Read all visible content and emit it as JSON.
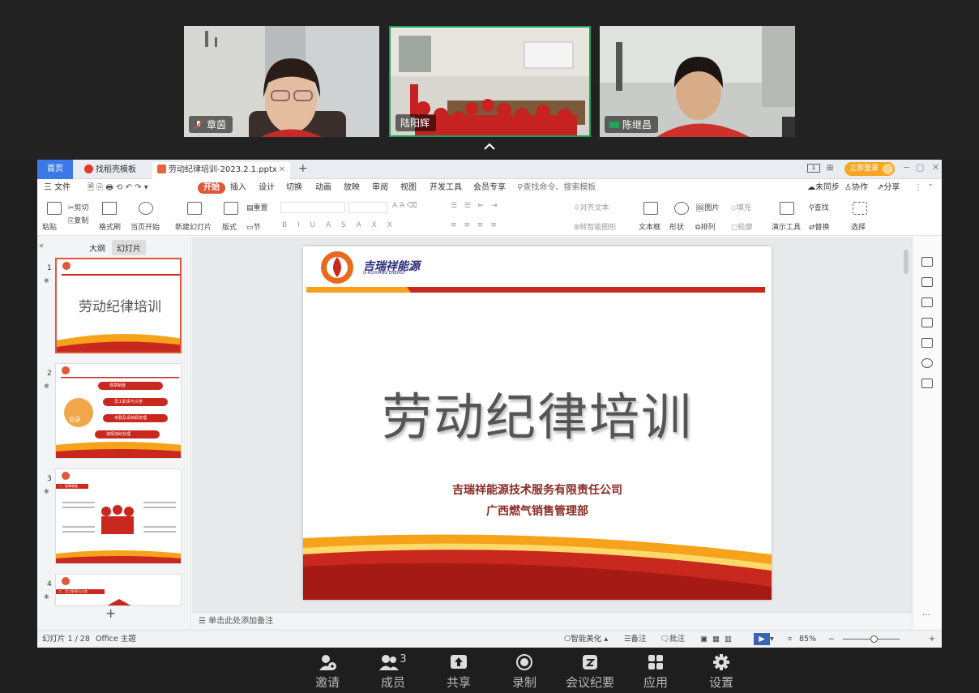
{
  "participants": [
    {
      "name": "章茵",
      "muted": true
    },
    {
      "name": "陆阳辉",
      "muted": false,
      "active": true
    },
    {
      "name": "陈继昌",
      "muted": false
    }
  ],
  "wps": {
    "tabs": {
      "home": "首页",
      "templates": "找稻壳模板",
      "document": "劳动纪律培训-2023.2.1.pptx"
    },
    "login": "立即登录",
    "menus": [
      "三 文件",
      "开始",
      "插入",
      "设计",
      "切换",
      "动画",
      "放映",
      "审阅",
      "视图",
      "开发工具",
      "会员专享"
    ],
    "search_placeholder": "查找命令、搜索模板",
    "top_right": {
      "sync": "未同步",
      "collab": "协作",
      "share": "分享"
    },
    "ribbon": {
      "paste": "粘贴",
      "cut": "剪切",
      "copy": "复制",
      "format_painter": "格式刷",
      "from_current": "当页开始",
      "new_slide": "新建幻灯片",
      "layout": "版式",
      "section": "节",
      "reset": "重置",
      "align_text": "对齐文本",
      "smartart": "转智能图形",
      "textbox": "文本框",
      "shape": "形状",
      "picture": "图片",
      "fill": "填充",
      "arrange": "排列",
      "outline": "轮廓",
      "presentation_tools": "演示工具",
      "find": "查找",
      "replace": "替换",
      "select": "选择"
    },
    "pane_tabs": {
      "outline": "大纲",
      "slides": "幻灯片"
    },
    "slide": {
      "logo_cn": "吉瑞祥能源",
      "logo_en": "G-RUIXIANG ENERGY",
      "title": "劳动纪律培训",
      "subtitle1": "吉瑞祥能源技术服务有限责任公司",
      "subtitle2": "广西燃气销售管理部"
    },
    "thumbs": {
      "t1_title": "劳动纪律培训",
      "t2_center": "目录",
      "t2_items": [
        "规章制度",
        "员工职责与义务",
        "考勤及请休假管理",
        "违规违纪处理"
      ],
      "t3_head": "一、规章制度",
      "t4_head": "二、员工职责与义务"
    },
    "notes_placeholder": "单击此处添加备注",
    "status": {
      "slide_count": "幻灯片 1 / 28",
      "theme": "Office 主题",
      "beautify": "智能美化",
      "notes": "备注",
      "comments": "批注",
      "zoom": "85%"
    }
  },
  "bottom_bar": [
    {
      "label": "邀请",
      "icon": "invite-icon"
    },
    {
      "label": "成员",
      "icon": "members-icon",
      "badge": "3"
    },
    {
      "label": "共享",
      "icon": "share-screen-icon"
    },
    {
      "label": "录制",
      "icon": "record-icon"
    },
    {
      "label": "会议纪要",
      "icon": "minutes-icon"
    },
    {
      "label": "应用",
      "icon": "apps-icon"
    },
    {
      "label": "设置",
      "icon": "settings-icon"
    }
  ]
}
